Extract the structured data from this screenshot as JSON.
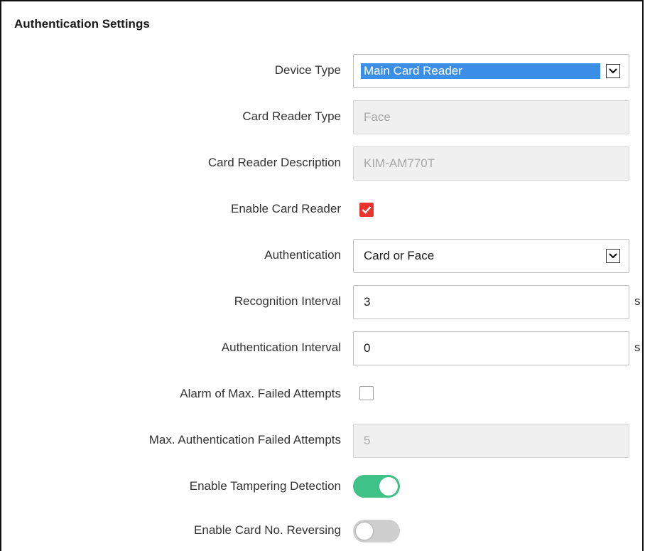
{
  "panel": {
    "title": "Authentication Settings"
  },
  "rows": {
    "device_type": {
      "label": "Device Type",
      "value": "Main Card Reader",
      "icon": "chevron-down-icon"
    },
    "card_reader_type": {
      "label": "Card Reader Type",
      "value": "Face"
    },
    "card_reader_description": {
      "label": "Card Reader Description",
      "value": "KIM-AM770T"
    },
    "enable_card_reader": {
      "label": "Enable Card Reader",
      "checked": true,
      "icon": "checkmark-icon"
    },
    "authentication": {
      "label": "Authentication",
      "value": "Card or Face",
      "icon": "chevron-down-icon"
    },
    "recognition_interval": {
      "label": "Recognition Interval",
      "value": "3",
      "unit": "s"
    },
    "authentication_interval": {
      "label": "Authentication Interval",
      "value": "0",
      "unit": "s"
    },
    "alarm_max_failed": {
      "label": "Alarm of Max. Failed Attempts",
      "checked": false
    },
    "max_auth_failed": {
      "label": "Max. Authentication Failed Attempts",
      "value": "5"
    },
    "tampering_detection": {
      "label": "Enable Tampering Detection",
      "on": true
    },
    "card_no_reversing": {
      "label": "Enable Card No. Reversing",
      "on": false
    }
  },
  "colors": {
    "highlight": "#3a8ee6",
    "checkbox_checked": "#e8332f",
    "toggle_on": "#3fc287",
    "toggle_off": "#cfcfcf"
  }
}
